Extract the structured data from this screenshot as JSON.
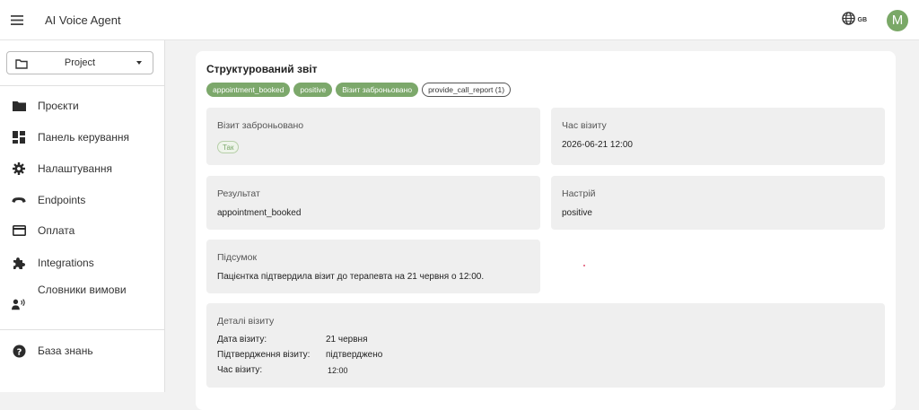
{
  "topbar": {
    "app_title": "AI Voice Agent",
    "lang_code": "GB",
    "avatar_initial": "M",
    "avatar_color": "#7aa867"
  },
  "sidebar": {
    "project_select": {
      "value": "Project",
      "icon": "folder-outline-icon"
    },
    "items": [
      {
        "label": "Проєкти",
        "icon": "folder-icon"
      },
      {
        "label": "Панель керування",
        "icon": "dashboard-icon"
      },
      {
        "label": "Налаштування",
        "icon": "gear-icon"
      },
      {
        "label": "Endpoints",
        "icon": "phone-icon"
      },
      {
        "label": "Оплата",
        "icon": "credit-card-icon"
      },
      {
        "label": "Integrations",
        "icon": "puzzle-icon"
      },
      {
        "label": "Словники вимови",
        "icon": "speaking-person-icon"
      }
    ],
    "knowledge_base": {
      "label": "База знань",
      "icon": "help-icon"
    }
  },
  "report": {
    "title": "Структурований звіт",
    "tags": [
      {
        "label": "appointment_booked",
        "style": "filled"
      },
      {
        "label": "positive",
        "style": "filled"
      },
      {
        "label": "Візит заброньовано",
        "style": "filled"
      },
      {
        "label": "provide_call_report (1)",
        "style": "outline"
      }
    ],
    "fields": {
      "booked": {
        "label": "Візит заброньовано",
        "value": "Так"
      },
      "visit_time": {
        "label": "Час візиту",
        "value": "2026-06-21 12:00"
      },
      "result": {
        "label": "Результат",
        "value": "appointment_booked"
      },
      "mood": {
        "label": "Настрій",
        "value": "positive"
      },
      "summary": {
        "label": "Підсумок",
        "value": "Пацієнтка підтвердила візит до терапевта на 21 червня о 12:00."
      }
    },
    "details": {
      "label": "Деталі візиту",
      "rows": [
        {
          "key": "Дата візиту:",
          "value": "21 червня"
        },
        {
          "key": "Підтвердження візиту:",
          "value": "підтверджено"
        },
        {
          "key": "Час візиту:",
          "value": "12:00"
        }
      ]
    }
  },
  "colors": {
    "accent_green": "#7ca86b",
    "panel_gray": "#efefef",
    "page_bg": "#f2f2f2"
  }
}
